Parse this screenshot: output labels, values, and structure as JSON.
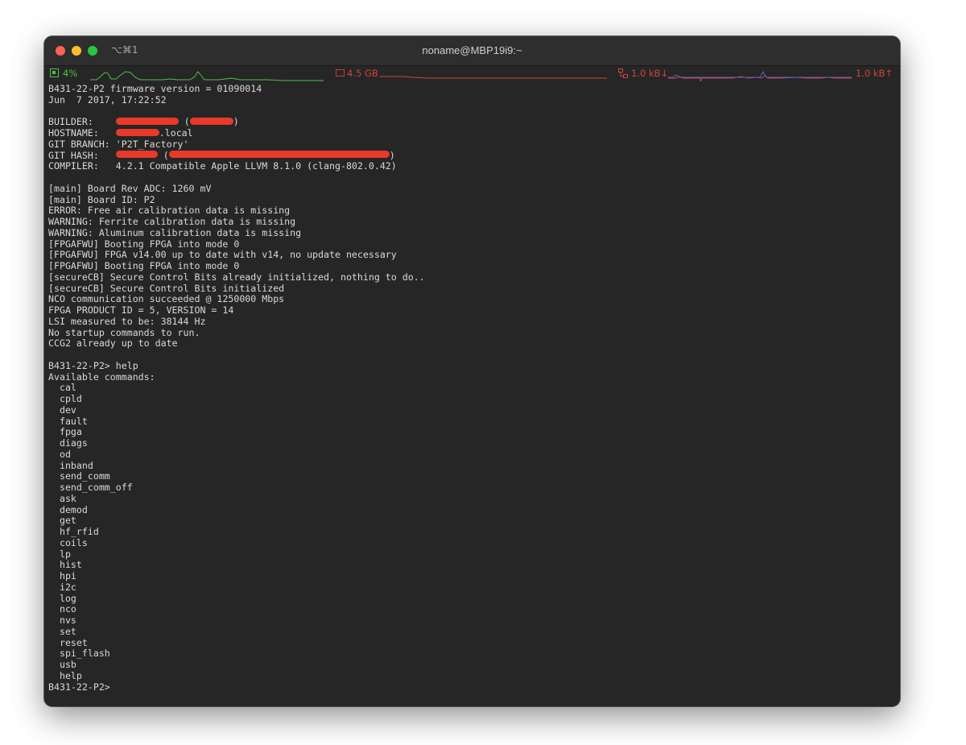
{
  "window": {
    "title": "noname@MBP19i9:~",
    "shortcut": "⌥⌘1"
  },
  "status": {
    "cpu": "4%",
    "memory": "4.5 GB",
    "net_down": "1.0 kB↓",
    "net_up": "1.0 kB↑"
  },
  "colors": {
    "cpu": "#4cc24a",
    "memory": "#d0443a",
    "redaction": "#e8392b"
  },
  "terminal": {
    "lines": [
      "B431-22-P2 firmware version = 01090014",
      "Jun  7 2017, 17:22:52",
      "",
      "BUILDER:    ",
      "HOSTNAME:   ",
      "GIT BRANCH: 'P2T_Factory'",
      "GIT HASH:   ",
      "COMPILER:   4.2.1 Compatible Apple LLVM 8.1.0 (clang-802.0.42)",
      "",
      "[main] Board Rev ADC: 1260 mV",
      "[main] Board ID: P2",
      "ERROR: Free air calibration data is missing",
      "WARNING: Ferrite calibration data is missing",
      "WARNING: Aluminum calibration data is missing",
      "[FPGAFWU] Booting FPGA into mode 0",
      "[FPGAFWU] FPGA v14.00 up to date with v14, no update necessary",
      "[FPGAFWU] Booting FPGA into mode 0",
      "[secureCB] Secure Control Bits already initialized, nothing to do..",
      "[secureCB] Secure Control Bits initialized",
      "NCO communication succeeded @ 1250000 Mbps",
      "FPGA PRODUCT ID = 5, VERSION = 14",
      "LSI measured to be: 38144 Hz",
      "No startup commands to run.",
      "CCG2 already up to date",
      "",
      "B431-22-P2> help",
      "Available commands:",
      "  cal",
      "  cpld",
      "  dev",
      "  fault",
      "  fpga",
      "  diags",
      "  od",
      "  inband",
      "  send_comm",
      "  send_comm_off",
      "  ask",
      "  demod",
      "  get",
      "  hf_rfid",
      "  coils",
      "  lp",
      "  hist",
      "  hpi",
      "  i2c",
      "  log",
      "  nco",
      "  nvs",
      "  set",
      "  reset",
      "  spi_flash",
      "  usb",
      "  help",
      "B431-22-P2>"
    ],
    "hostname_suffix": ".local",
    "paren_open": "(",
    "paren_close": ")"
  }
}
